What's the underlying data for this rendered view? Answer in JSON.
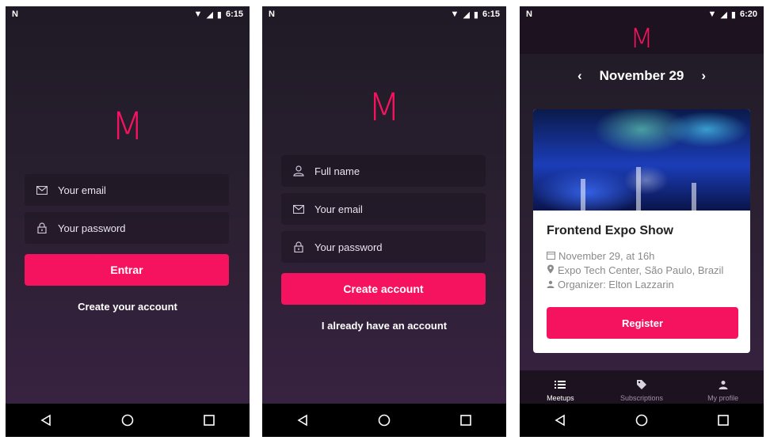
{
  "colors": {
    "accent": "#f5135f",
    "bg_top": "#1f1a25",
    "bg_bottom": "#3a2244"
  },
  "logo": "M",
  "screens": [
    {
      "status": {
        "carrier": "N",
        "time": "6:15"
      },
      "email_placeholder": "Your email",
      "password_placeholder": "Your password",
      "submit_label": "Entrar",
      "link_label": "Create your account"
    },
    {
      "status": {
        "carrier": "N",
        "time": "6:15"
      },
      "name_placeholder": "Full name",
      "email_placeholder": "Your email",
      "password_placeholder": "Your password",
      "submit_label": "Create account",
      "link_label": "I already have an account"
    },
    {
      "status": {
        "carrier": "N",
        "time": "6:20"
      },
      "date_label": "November 29",
      "event": {
        "title": "Frontend Expo Show",
        "date": "November 29, at 16h",
        "location": "Expo Tech Center, São Paulo, Brazil",
        "organizer": "Organizer: Elton Lazzarin",
        "button": "Register"
      },
      "tabs": [
        {
          "label": "Meetups",
          "icon": "list-icon",
          "active": true
        },
        {
          "label": "Subscriptions",
          "icon": "tag-icon",
          "active": false
        },
        {
          "label": "My profile",
          "icon": "person-icon",
          "active": false
        }
      ]
    }
  ]
}
